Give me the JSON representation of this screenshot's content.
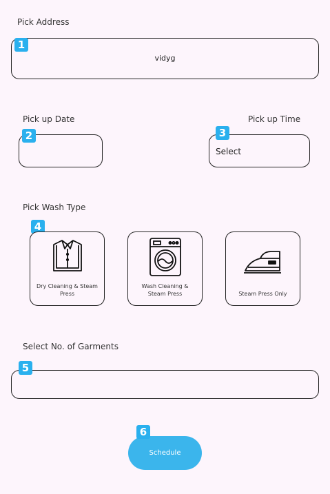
{
  "pick_address": {
    "label": "Pick Address",
    "value": "vidyg",
    "badge": "1"
  },
  "pick_up_date": {
    "label": "Pick up Date",
    "value": "",
    "badge": "2"
  },
  "pick_up_time": {
    "label": "Pick up Time",
    "value": "Select",
    "badge": "3"
  },
  "wash_type": {
    "label": "Pick Wash Type",
    "badge": "4",
    "options": [
      {
        "label": "Dry Cleaning & Steam Press",
        "icon": "folded-shirt-icon"
      },
      {
        "label": "Wash Cleaning & Steam Press",
        "icon": "washing-machine-icon"
      },
      {
        "label": "Steam Press Only",
        "icon": "iron-icon"
      }
    ]
  },
  "garments": {
    "label": "Select No. of Garments",
    "value": "",
    "badge": "5"
  },
  "schedule": {
    "label": "Schedule",
    "badge": "6"
  },
  "colors": {
    "accent": "#2ab0ee",
    "button": "#3bb5ec",
    "background": "#fdf5fc"
  }
}
